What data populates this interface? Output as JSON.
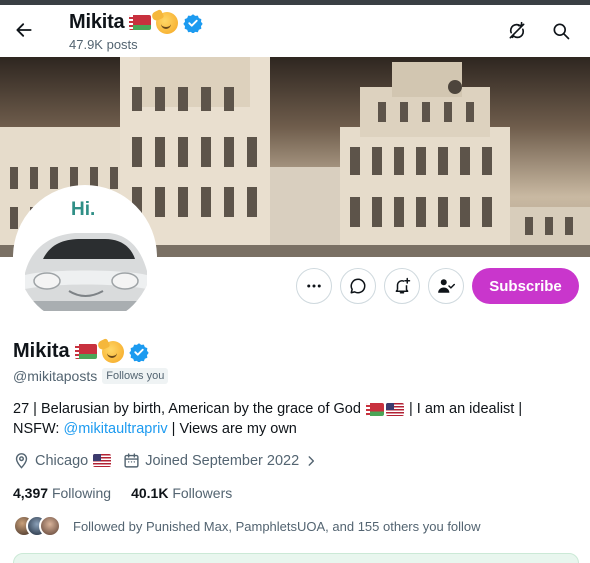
{
  "header": {
    "back_label": "Back",
    "name": "Mikita",
    "posts_count": "47.9K posts"
  },
  "icons": {
    "back": "arrow-left-icon",
    "hide_reposts": "hide-reposts-icon",
    "search": "search-icon",
    "more": "more-horizontal-icon",
    "message": "message-bubble-icon",
    "notify": "bell-plus-icon",
    "following": "person-check-icon",
    "location": "location-pin-icon",
    "calendar": "calendar-icon",
    "chevron": "chevron-right-icon",
    "verified": "verified-badge-icon"
  },
  "banner": {
    "description": ""
  },
  "avatar": {
    "text": "Hi."
  },
  "actions": {
    "subscribe_label": "Subscribe"
  },
  "profile": {
    "name": "Mikita",
    "handle": "@mikitaposts",
    "follows_you": "Follows you",
    "bio_line1": "27 | Belarusian by birth, American by the grace of God",
    "bio_line1_end": "| I am an idealist |",
    "bio_line2_start": "NSFW:",
    "bio_link": "@mikitaultrapriv",
    "bio_line2_end": "| Views are my own",
    "location": "Chicago",
    "joined": "Joined September 2022"
  },
  "stats": {
    "following_count": "4,397",
    "following_label": "Following",
    "followers_count": "40.1K",
    "followers_label": "Followers"
  },
  "followed_by": {
    "text": "Followed by Punished Max, PamphletsUOA, and 155 others you follow"
  },
  "colors": {
    "subscribe": "#c936cc",
    "link": "#1d9bf0",
    "verified": "#1d9bf0",
    "muted_text": "#536471"
  }
}
